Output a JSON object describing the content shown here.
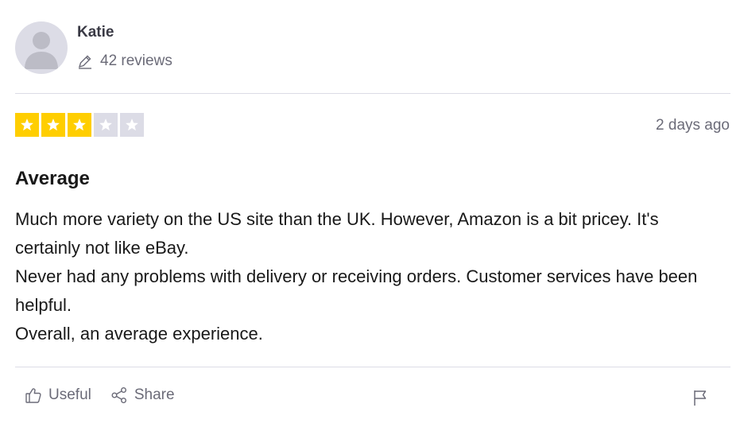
{
  "reviewer": {
    "name": "Katie",
    "review_count": "42 reviews",
    "avatar_icon": "person-silhouette-icon"
  },
  "rating": {
    "score": 3,
    "max": 5,
    "filled_color": "#ffce00",
    "empty_color": "#dcdce6",
    "star_color": "#ffffff"
  },
  "date": "2 days ago",
  "review": {
    "title": "Average",
    "paragraphs": [
      "Much more variety on the US site than the UK. However, Amazon is a bit pricey. It's certainly not like eBay.",
      "Never had any problems with delivery or receiving orders. Customer services have been helpful.",
      "Overall, an average experience."
    ]
  },
  "actions": {
    "useful_label": "Useful",
    "share_label": "Share",
    "useful_icon": "thumbs-up-icon",
    "share_icon": "share-icon",
    "report_icon": "flag-icon"
  }
}
